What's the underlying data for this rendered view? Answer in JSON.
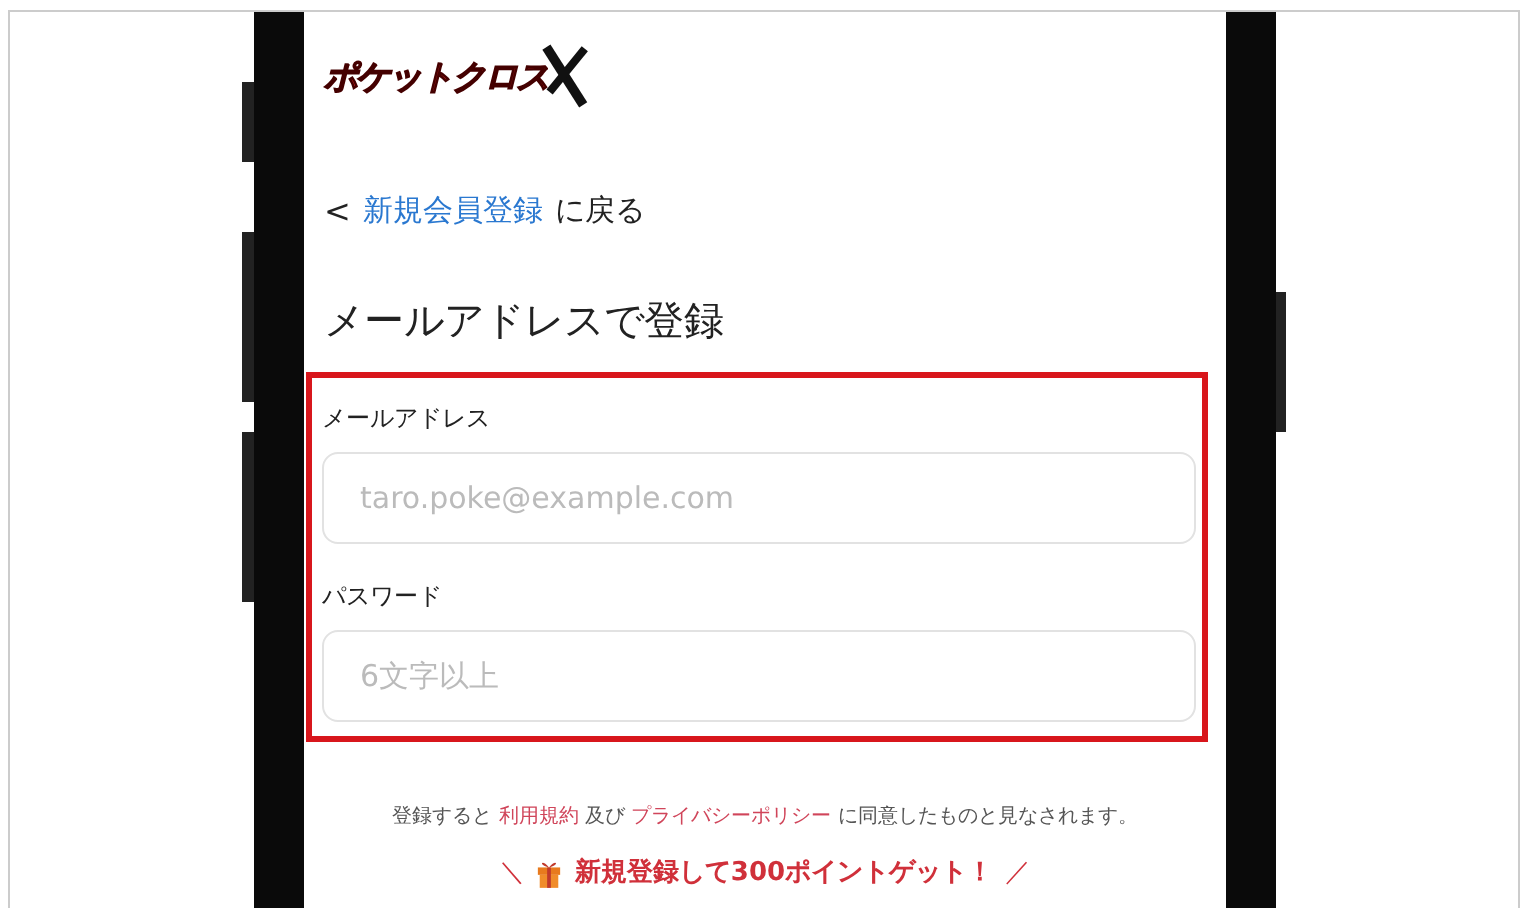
{
  "logo": {
    "text": "ポケットクロス"
  },
  "back_link": {
    "chevron": "<",
    "link": "新規会員登録",
    "suffix": "に戻る"
  },
  "title": "メールアドレスで登録",
  "fields": [
    {
      "label": "メールアドレス",
      "placeholder": "taro.poke@example.com"
    },
    {
      "label": "パスワード",
      "placeholder": "6文字以上"
    }
  ],
  "agreement": {
    "before": "登録すると",
    "terms_link": "利用規約",
    "middle": "及び",
    "privacy_link": "プライバシーポリシー",
    "after": "に同意したものと見なされます。"
  },
  "promo": {
    "left": "＼",
    "text": "新規登録して300ポイントゲット！",
    "right": "／"
  }
}
